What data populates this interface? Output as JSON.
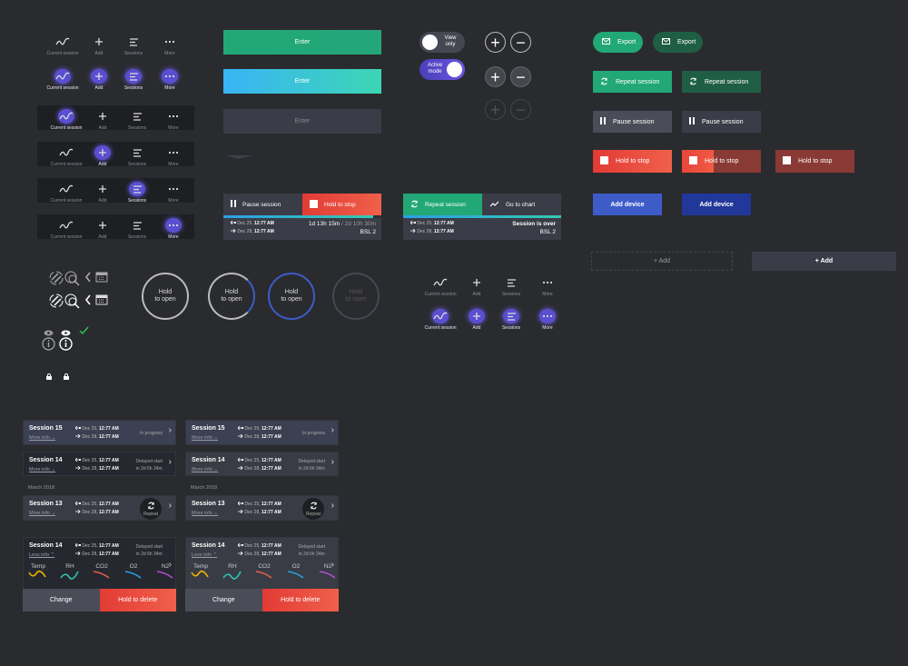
{
  "nav": {
    "items": [
      "Current session",
      "Add",
      "Sessions",
      "More"
    ],
    "rows": [
      {
        "active": "none",
        "bg": false
      },
      {
        "active": "all",
        "bg": false
      },
      {
        "active": 0,
        "bg": true
      },
      {
        "active": 1,
        "bg": true
      },
      {
        "active": 2,
        "bg": true
      },
      {
        "active": 3,
        "bg": true
      }
    ],
    "rows2": [
      {
        "active": "none"
      },
      {
        "active": "all"
      }
    ]
  },
  "enter": {
    "label": "Enter"
  },
  "toggles": {
    "off": "View only",
    "on": "Active mode"
  },
  "controls": {
    "pause": "Pause session",
    "stop": "Hold to stop",
    "repeat": "Repeat session",
    "chart": "Go to chart",
    "start_date": "Dec 25,",
    "start_time": "12:77 AM",
    "end_date": "Dec 28,",
    "end_time": "12:77 AM",
    "elapsed": "1d 13h 15m",
    "total": "/ 2d 10h 30m",
    "location": "BSL 2",
    "over": "Session is over",
    "progress": 0.95
  },
  "buttons": {
    "export": "Export",
    "repeat": "Repeat session",
    "pause": "Pause session",
    "stop": "Hold to stop",
    "add_device": "Add device",
    "add": "+ Add"
  },
  "hold": {
    "label1": "Hold",
    "label2": "to open",
    "progress": [
      0,
      0.35,
      1,
      0
    ]
  },
  "sessions": {
    "s15": "Session 15",
    "s14": "Session 14",
    "s13": "Session 13",
    "more": "More info",
    "less": "Less info",
    "in_progress": "In progress",
    "delayed": "Delayed start",
    "delay_time": "in 2d 6h 34m",
    "month": "March 2018",
    "repeat": "Repeat",
    "change": "Change",
    "delete": "Hold to delete",
    "gases": [
      {
        "name": "Temp",
        "color": "#e8b400"
      },
      {
        "name": "RH",
        "color": "#2ec4b0"
      },
      {
        "name": "CO2",
        "color": "#e8604c"
      },
      {
        "name": "O2",
        "color": "#2aa0e8"
      },
      {
        "name": "N2",
        "color": "#b04ed0"
      }
    ]
  },
  "colors": {
    "accent": "#5a4fd0",
    "green": "#22a877",
    "red": "#e8463a",
    "blue": "#3d5cc8"
  }
}
